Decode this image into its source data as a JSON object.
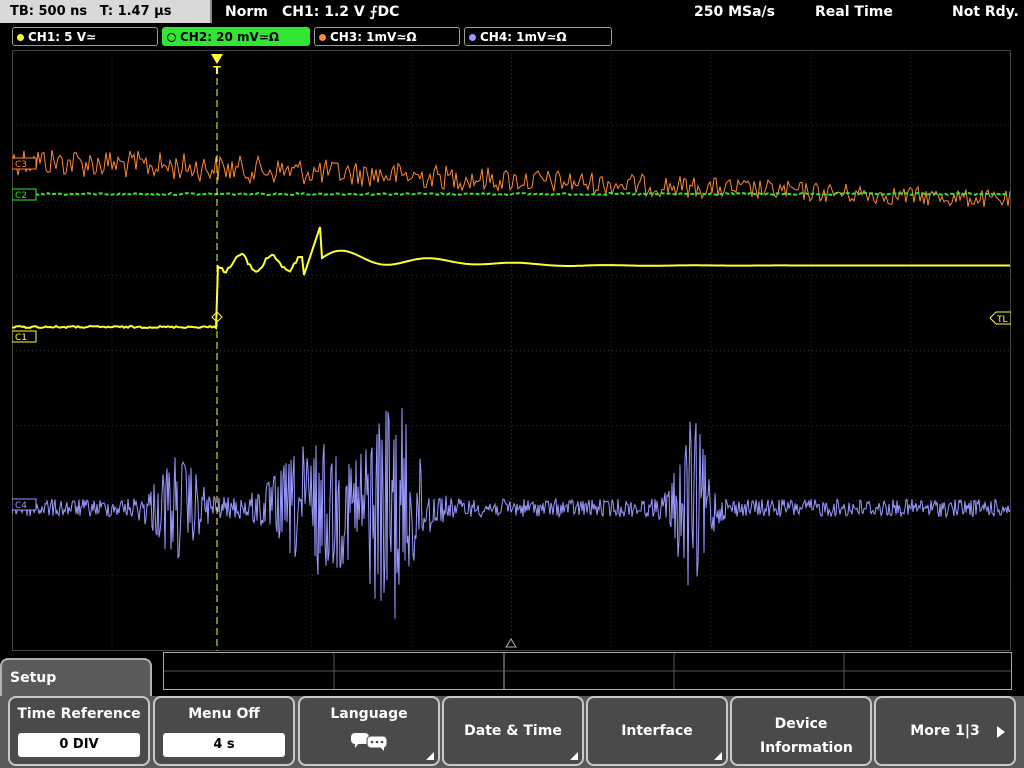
{
  "topbar": {
    "timebase": "TB: 500 ns",
    "trigger_time": "T: 1.47 µs",
    "mode": "Norm",
    "trigger_info": "CH1: 1.2 V ⨍DC",
    "sample_rate": "250 MSa/s",
    "acq_mode": "Real Time",
    "status": "Not Rdy."
  },
  "channels": [
    {
      "label": "CH1: 5 V≃",
      "color": "#ffff33",
      "active": false
    },
    {
      "label": "CH2: 20 mV≃Ω",
      "color": "#33e533",
      "active": true
    },
    {
      "label": "CH3: 1mV≃Ω",
      "color": "#ff8833",
      "active": false
    },
    {
      "label": "CH4: 1mV≃Ω",
      "color": "#9999ff",
      "active": false
    }
  ],
  "markers": {
    "ch3": "C3",
    "ch2": "C2",
    "ch1": "C1",
    "ch4": "C4",
    "trigger_level": "TL",
    "trigger_pos": "T"
  },
  "colors": {
    "ch1": "#ffff33",
    "ch2": "#33e533",
    "ch3": "#ff8833",
    "ch4": "#9999ff",
    "grid": "#2a2a2a"
  },
  "menu": {
    "title": "Setup",
    "softkeys": [
      {
        "label": "Time Reference",
        "value": "0 DIV"
      },
      {
        "label": "Menu Off",
        "value": "4 s"
      },
      {
        "label": "Language",
        "icon": "speech-bubbles-icon"
      },
      {
        "label": "Date & Time"
      },
      {
        "label": "Interface"
      },
      {
        "label": "Device Information"
      },
      {
        "label": "More 1|3"
      }
    ]
  }
}
